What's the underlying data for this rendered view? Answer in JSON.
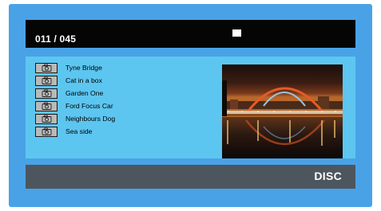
{
  "header": {
    "counter": "011 / 045",
    "stop_icon": "stop-icon"
  },
  "playlist": {
    "items": [
      {
        "label": "Tyne Bridge",
        "icon": "camera-icon"
      },
      {
        "label": "Cat in a box",
        "icon": "camera-icon"
      },
      {
        "label": "Garden One",
        "icon": "camera-icon"
      },
      {
        "label": "Ford Focus Car",
        "icon": "camera-icon"
      },
      {
        "label": "Neighbours Dog",
        "icon": "camera-icon"
      },
      {
        "label": "Sea side",
        "icon": "camera-icon"
      }
    ],
    "selected_index": 0
  },
  "preview": {
    "icon": "photo-preview-tyne-bridge"
  },
  "footer": {
    "source_label": "DISC"
  },
  "colors": {
    "frame": "#4aa2e6",
    "panel": "#5cc6f0",
    "topbar": "#050505",
    "bottombar": "#4d565f"
  }
}
